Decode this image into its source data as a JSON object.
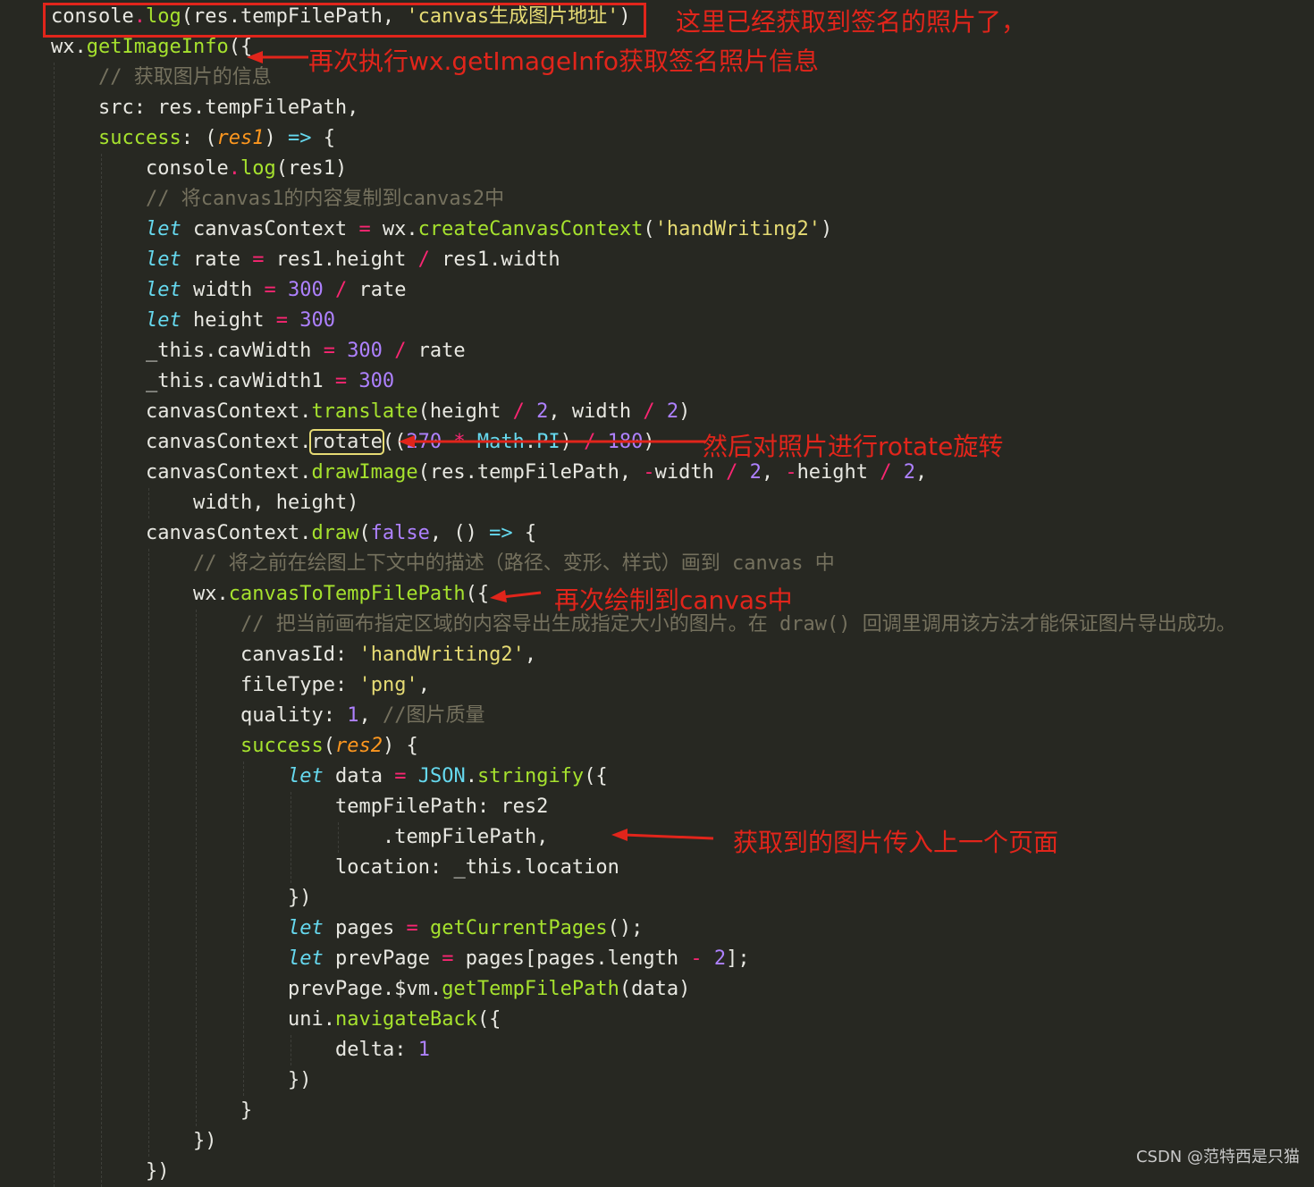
{
  "code": [
    {
      "indent": 0,
      "tokens": [
        [
          "pl",
          "console"
        ],
        [
          "op",
          "."
        ],
        [
          "fn",
          "log"
        ],
        [
          "pl",
          "(res.tempFilePath, "
        ],
        [
          "str",
          "'canvas生成图片地址'"
        ],
        [
          "pl",
          ")"
        ]
      ]
    },
    {
      "indent": 0,
      "tokens": [
        [
          "pl",
          "wx."
        ],
        [
          "fn",
          "getImageInfo"
        ],
        [
          "pl",
          "({"
        ]
      ]
    },
    {
      "indent": 1,
      "tokens": [
        [
          "cm",
          "// 获取图片的信息"
        ]
      ]
    },
    {
      "indent": 1,
      "tokens": [
        [
          "pl",
          "src: res.tempFilePath,"
        ]
      ]
    },
    {
      "indent": 1,
      "tokens": [
        [
          "fn",
          "success"
        ],
        [
          "pl",
          ": ("
        ],
        [
          "par",
          "res1"
        ],
        [
          "pl",
          ") "
        ],
        [
          "kw",
          "=>"
        ],
        [
          "pl",
          " {"
        ]
      ]
    },
    {
      "indent": 2,
      "tokens": [
        [
          "pl",
          "console"
        ],
        [
          "op",
          "."
        ],
        [
          "fn",
          "log"
        ],
        [
          "pl",
          "(res1)"
        ]
      ]
    },
    {
      "indent": 2,
      "tokens": [
        [
          "cm",
          "// 将canvas1的内容复制到canvas2中"
        ]
      ]
    },
    {
      "indent": 2,
      "tokens": [
        [
          "kw",
          "let"
        ],
        [
          "pl",
          " canvasContext "
        ],
        [
          "op",
          "="
        ],
        [
          "pl",
          " wx."
        ],
        [
          "fn",
          "createCanvasContext"
        ],
        [
          "pl",
          "("
        ],
        [
          "str",
          "'handWriting2'"
        ],
        [
          "pl",
          ")"
        ]
      ]
    },
    {
      "indent": 2,
      "tokens": [
        [
          "kw",
          "let"
        ],
        [
          "pl",
          " rate "
        ],
        [
          "op",
          "="
        ],
        [
          "pl",
          " res1.height "
        ],
        [
          "op",
          "/"
        ],
        [
          "pl",
          " res1.width"
        ]
      ]
    },
    {
      "indent": 2,
      "tokens": [
        [
          "kw",
          "let"
        ],
        [
          "pl",
          " width "
        ],
        [
          "op",
          "="
        ],
        [
          "pl",
          " "
        ],
        [
          "num",
          "300"
        ],
        [
          "pl",
          " "
        ],
        [
          "op",
          "/"
        ],
        [
          "pl",
          " rate"
        ]
      ]
    },
    {
      "indent": 2,
      "tokens": [
        [
          "kw",
          "let"
        ],
        [
          "pl",
          " height "
        ],
        [
          "op",
          "="
        ],
        [
          "pl",
          " "
        ],
        [
          "num",
          "300"
        ]
      ]
    },
    {
      "indent": 2,
      "tokens": [
        [
          "pl",
          "_this.cavWidth "
        ],
        [
          "op",
          "="
        ],
        [
          "pl",
          " "
        ],
        [
          "num",
          "300"
        ],
        [
          "pl",
          " "
        ],
        [
          "op",
          "/"
        ],
        [
          "pl",
          " rate"
        ]
      ]
    },
    {
      "indent": 2,
      "tokens": [
        [
          "pl",
          "_this.cavWidth1 "
        ],
        [
          "op",
          "="
        ],
        [
          "pl",
          " "
        ],
        [
          "num",
          "300"
        ]
      ]
    },
    {
      "indent": 2,
      "tokens": [
        [
          "pl",
          "canvasContext."
        ],
        [
          "fn",
          "translate"
        ],
        [
          "pl",
          "(height "
        ],
        [
          "op",
          "/"
        ],
        [
          "pl",
          " "
        ],
        [
          "num",
          "2"
        ],
        [
          "pl",
          ", width "
        ],
        [
          "op",
          "/"
        ],
        [
          "pl",
          " "
        ],
        [
          "num",
          "2"
        ],
        [
          "pl",
          ")"
        ]
      ]
    },
    {
      "indent": 2,
      "tokens": [
        [
          "pl",
          "canvasContext."
        ],
        [
          "hl",
          "rotate"
        ],
        [
          "pl",
          "(("
        ],
        [
          "num",
          "270"
        ],
        [
          "pl",
          " "
        ],
        [
          "op",
          "*"
        ],
        [
          "pl",
          " "
        ],
        [
          "cls",
          "Math"
        ],
        [
          "pl",
          "."
        ],
        [
          "cls",
          "PI"
        ],
        [
          "pl",
          ") "
        ],
        [
          "op",
          "/"
        ],
        [
          "pl",
          " "
        ],
        [
          "num",
          "180"
        ],
        [
          "pl",
          ")"
        ]
      ]
    },
    {
      "indent": 2,
      "tokens": [
        [
          "pl",
          "canvasContext."
        ],
        [
          "fn",
          "drawImage"
        ],
        [
          "pl",
          "(res.tempFilePath, "
        ],
        [
          "op",
          "-"
        ],
        [
          "pl",
          "width "
        ],
        [
          "op",
          "/"
        ],
        [
          "pl",
          " "
        ],
        [
          "num",
          "2"
        ],
        [
          "pl",
          ", "
        ],
        [
          "op",
          "-"
        ],
        [
          "pl",
          "height "
        ],
        [
          "op",
          "/"
        ],
        [
          "pl",
          " "
        ],
        [
          "num",
          "2"
        ],
        [
          "pl",
          ","
        ]
      ]
    },
    {
      "indent": 3,
      "tokens": [
        [
          "pl",
          "width, height)"
        ]
      ]
    },
    {
      "indent": 2,
      "tokens": [
        [
          "pl",
          "canvasContext."
        ],
        [
          "fn",
          "draw"
        ],
        [
          "pl",
          "("
        ],
        [
          "num",
          "false"
        ],
        [
          "pl",
          ", () "
        ],
        [
          "kw",
          "=>"
        ],
        [
          "pl",
          " {"
        ]
      ]
    },
    {
      "indent": 3,
      "tokens": [
        [
          "cm",
          "// 将之前在绘图上下文中的描述（路径、变形、样式）画到 canvas 中"
        ]
      ]
    },
    {
      "indent": 3,
      "tokens": [
        [
          "pl",
          "wx."
        ],
        [
          "fn",
          "canvasToTempFilePath"
        ],
        [
          "pl",
          "({"
        ]
      ]
    },
    {
      "indent": 4,
      "tokens": [
        [
          "cm",
          "// 把当前画布指定区域的内容导出生成指定大小的图片。在 draw() 回调里调用该方法才能保证图片导出成功。"
        ]
      ]
    },
    {
      "indent": 4,
      "tokens": [
        [
          "pl",
          "canvasId: "
        ],
        [
          "str",
          "'handWriting2'"
        ],
        [
          "pl",
          ","
        ]
      ]
    },
    {
      "indent": 4,
      "tokens": [
        [
          "pl",
          "fileType: "
        ],
        [
          "str",
          "'png'"
        ],
        [
          "pl",
          ","
        ]
      ]
    },
    {
      "indent": 4,
      "tokens": [
        [
          "pl",
          "quality: "
        ],
        [
          "num",
          "1"
        ],
        [
          "pl",
          ", "
        ],
        [
          "cm",
          "//图片质量"
        ]
      ]
    },
    {
      "indent": 4,
      "tokens": [
        [
          "fn",
          "success"
        ],
        [
          "pl",
          "("
        ],
        [
          "par",
          "res2"
        ],
        [
          "pl",
          ") {"
        ]
      ]
    },
    {
      "indent": 5,
      "tokens": [
        [
          "kw",
          "let"
        ],
        [
          "pl",
          " data "
        ],
        [
          "op",
          "="
        ],
        [
          "pl",
          " "
        ],
        [
          "cls",
          "JSON"
        ],
        [
          "pl",
          "."
        ],
        [
          "fn",
          "stringify"
        ],
        [
          "pl",
          "({"
        ]
      ]
    },
    {
      "indent": 6,
      "tokens": [
        [
          "pl",
          "tempFilePath: res2"
        ]
      ]
    },
    {
      "indent": 7,
      "tokens": [
        [
          "pl",
          ".tempFilePath,"
        ]
      ]
    },
    {
      "indent": 6,
      "tokens": [
        [
          "pl",
          "location: _this.location"
        ]
      ]
    },
    {
      "indent": 5,
      "tokens": [
        [
          "pl",
          "})"
        ]
      ]
    },
    {
      "indent": 5,
      "tokens": [
        [
          "kw",
          "let"
        ],
        [
          "pl",
          " pages "
        ],
        [
          "op",
          "="
        ],
        [
          "pl",
          " "
        ],
        [
          "fn",
          "getCurrentPages"
        ],
        [
          "pl",
          "();"
        ]
      ]
    },
    {
      "indent": 5,
      "tokens": [
        [
          "kw",
          "let"
        ],
        [
          "pl",
          " prevPage "
        ],
        [
          "op",
          "="
        ],
        [
          "pl",
          " pages[pages.length "
        ],
        [
          "op",
          "-"
        ],
        [
          "pl",
          " "
        ],
        [
          "num",
          "2"
        ],
        [
          "pl",
          "];"
        ]
      ]
    },
    {
      "indent": 5,
      "tokens": [
        [
          "pl",
          "prevPage.$vm."
        ],
        [
          "fn",
          "getTempFilePath"
        ],
        [
          "pl",
          "(data)"
        ]
      ]
    },
    {
      "indent": 5,
      "tokens": [
        [
          "pl",
          "uni."
        ],
        [
          "fn",
          "navigateBack"
        ],
        [
          "pl",
          "({"
        ]
      ]
    },
    {
      "indent": 6,
      "tokens": [
        [
          "pl",
          "delta: "
        ],
        [
          "num",
          "1"
        ]
      ]
    },
    {
      "indent": 5,
      "tokens": [
        [
          "pl",
          "})"
        ]
      ]
    },
    {
      "indent": 4,
      "tokens": [
        [
          "pl",
          "}"
        ]
      ]
    },
    {
      "indent": 3,
      "tokens": [
        [
          "pl",
          "})"
        ]
      ]
    },
    {
      "indent": 2,
      "tokens": [
        [
          "pl",
          "})"
        ]
      ]
    }
  ],
  "annotations": {
    "signature_obtained": "这里已经获取到签名的照片了，",
    "get_image_info_again": "再次执行wx.getImageInfo获取签名照片信息",
    "rotate_photo": "然后对照片进行rotate旋转",
    "draw_to_canvas_again": "再次绘制到canvas中",
    "pass_to_previous_page": "获取到的图片传入上一个页面"
  },
  "watermark": "CSDN @范特西是只猫",
  "colors": {
    "background": "#272822",
    "plain": "#e8e8e2",
    "function": "#a6e22e",
    "operator": "#f92672",
    "number": "#ae81ff",
    "string": "#e6db74",
    "keyword": "#66d9ef",
    "parameter": "#fd971f",
    "comment": "#75715e",
    "annotation": "#e1251b"
  }
}
